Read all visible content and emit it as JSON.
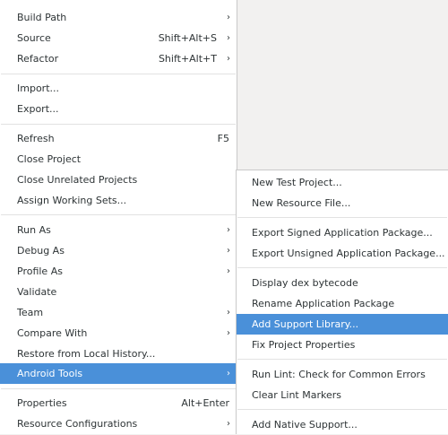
{
  "main_menu": {
    "items": [
      {
        "label": "Build Path",
        "shortcut": "",
        "submenu": true
      },
      {
        "label": "Source",
        "shortcut": "Shift+Alt+S",
        "submenu": true
      },
      {
        "label": "Refactor",
        "shortcut": "Shift+Alt+T",
        "submenu": true
      },
      {
        "label": "Import...",
        "shortcut": "",
        "submenu": false
      },
      {
        "label": "Export...",
        "shortcut": "",
        "submenu": false
      },
      {
        "label": "Refresh",
        "shortcut": "F5",
        "submenu": false
      },
      {
        "label": "Close Project",
        "shortcut": "",
        "submenu": false
      },
      {
        "label": "Close Unrelated Projects",
        "shortcut": "",
        "submenu": false
      },
      {
        "label": "Assign Working Sets...",
        "shortcut": "",
        "submenu": false
      },
      {
        "label": "Run As",
        "shortcut": "",
        "submenu": true
      },
      {
        "label": "Debug As",
        "shortcut": "",
        "submenu": true
      },
      {
        "label": "Profile As",
        "shortcut": "",
        "submenu": true
      },
      {
        "label": "Validate",
        "shortcut": "",
        "submenu": false
      },
      {
        "label": "Team",
        "shortcut": "",
        "submenu": true
      },
      {
        "label": "Compare With",
        "shortcut": "",
        "submenu": true
      },
      {
        "label": "Restore from Local History...",
        "shortcut": "",
        "submenu": false
      },
      {
        "label": "Android Tools",
        "shortcut": "",
        "submenu": true
      },
      {
        "label": "Properties",
        "shortcut": "Alt+Enter",
        "submenu": false
      },
      {
        "label": "Resource Configurations",
        "shortcut": "",
        "submenu": true
      }
    ]
  },
  "sub_menu": {
    "items": [
      {
        "label": "New Test Project..."
      },
      {
        "label": "New Resource File..."
      },
      {
        "label": "Export Signed Application Package..."
      },
      {
        "label": "Export Unsigned Application Package..."
      },
      {
        "label": "Display dex bytecode"
      },
      {
        "label": "Rename Application Package"
      },
      {
        "label": "Add Support Library..."
      },
      {
        "label": "Fix Project Properties"
      },
      {
        "label": "Run Lint: Check for Common Errors"
      },
      {
        "label": "Clear Lint Markers"
      },
      {
        "label": "Add Native Support..."
      }
    ]
  },
  "icons": {
    "submenu_arrow": "›"
  },
  "colors": {
    "highlight": "#4a90d9",
    "menu_bg": "#ffffff",
    "text": "#2e3436"
  }
}
